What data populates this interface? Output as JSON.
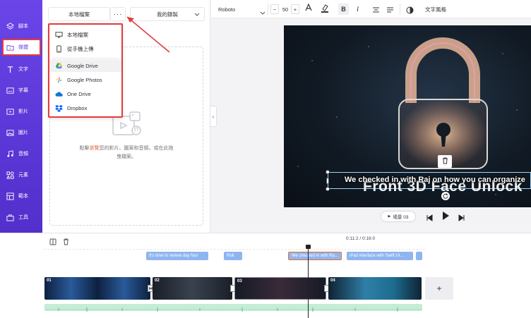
{
  "sidebar": {
    "items": [
      {
        "label": "腳本",
        "icon": "layers-icon"
      },
      {
        "label": "媒體",
        "icon": "folder-media-icon"
      },
      {
        "label": "文字",
        "icon": "text-icon"
      },
      {
        "label": "字幕",
        "icon": "subtitle-icon"
      },
      {
        "label": "影片",
        "icon": "video-icon"
      },
      {
        "label": "圖片",
        "icon": "image-icon"
      },
      {
        "label": "音頻",
        "icon": "music-icon"
      },
      {
        "label": "元素",
        "icon": "elements-icon"
      },
      {
        "label": "範本",
        "icon": "template-icon"
      },
      {
        "label": "工具",
        "icon": "toolbox-icon"
      }
    ],
    "active_index": 1
  },
  "panel": {
    "tab_local": "本地檔案",
    "more_label": "···",
    "tab_library": "我的錄製",
    "drop_text_prefix": "點擊",
    "drop_text_highlight": "瀏覽",
    "drop_text_suffix": "您的影片、圖案和音頻，或在此拖曳檔案。"
  },
  "dropdown": {
    "items": [
      {
        "label": "本地檔案",
        "icon": "monitor-icon"
      },
      {
        "label": "從手機上傳",
        "icon": "phone-icon"
      },
      {
        "label": "Google Drive",
        "icon": "google-drive-icon"
      },
      {
        "label": "Google Photos",
        "icon": "google-photos-icon"
      },
      {
        "label": "One Drive",
        "icon": "onedrive-icon"
      },
      {
        "label": "Dropbox",
        "icon": "dropbox-icon"
      }
    ]
  },
  "toolbar": {
    "font": "Roboto",
    "font_size": "50",
    "minus": "−",
    "plus": "+",
    "text_style": "文字風格"
  },
  "canvas": {
    "caption": "We checked in with Raj on how you can organize",
    "title_text": "Front 3D Face Unlock"
  },
  "playback": {
    "scene_label": "場景 03",
    "time": "0:11:2 / 0:16:0"
  },
  "timeline": {
    "chips": [
      "It's time to review day four",
      "Roll",
      "We checked in with Ra...",
      "iPad interface with Swift UI..."
    ],
    "clips": [
      {
        "num": "01"
      },
      {
        "num": "02"
      },
      {
        "num": "03"
      },
      {
        "num": "04"
      }
    ],
    "add_label": "+"
  },
  "colors": {
    "accent": "#6b45e8",
    "highlight_red": "#e23b3b",
    "chip_blue": "#8fb5f0"
  }
}
